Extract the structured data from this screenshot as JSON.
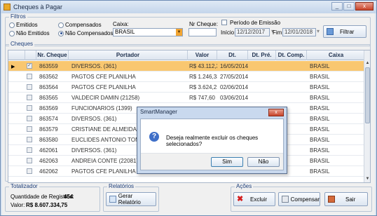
{
  "window": {
    "title": "Cheques à Pagar",
    "min": "_",
    "max": "□",
    "close": "x"
  },
  "filtros": {
    "legend": "Filtros",
    "radios_left": [
      {
        "label": "Emitidos",
        "checked": false
      },
      {
        "label": "Não Emitidos",
        "checked": false
      }
    ],
    "radios_mid": [
      {
        "label": "Compensados",
        "checked": false
      },
      {
        "label": "Não Compensados",
        "checked": true
      }
    ],
    "caixa_label": "Caixa:",
    "caixa_value": "BRASIL",
    "nr_cheque_label": "Nr Cheque:",
    "nr_cheque_value": "",
    "periodo_label": "Período de Emissão",
    "inicio_label": "Início:",
    "inicio_value": "12/12/2017",
    "fim_label": "Fim:",
    "fim_value": "12/01/2018",
    "filtrar_label": "Filtrar"
  },
  "grid": {
    "legend": "Cheques",
    "columns": [
      "Nr. Cheque",
      "Portador",
      "Valor",
      "Dt. Emissão",
      "Dt. Pré.",
      "Dt. Comp.",
      "Caixa"
    ],
    "rows": [
      {
        "nr": "863559",
        "portador": "DIVERSOS. (361)",
        "valor": "R$ 43.112,34",
        "emissao": "16/05/2014",
        "pre": "",
        "comp": "",
        "caixa": "BRASIL",
        "selected": true
      },
      {
        "nr": "863562",
        "portador": "PAGTOS CFE PLANILHA",
        "valor": "R$ 1.246,33",
        "emissao": "27/05/2014",
        "pre": "",
        "comp": "",
        "caixa": "BRASIL",
        "selected": false
      },
      {
        "nr": "863564",
        "portador": "PAGTOS CFE PLANILHA",
        "valor": "R$ 3.624,21",
        "emissao": "02/06/2014",
        "pre": "",
        "comp": "",
        "caixa": "BRASIL",
        "selected": false
      },
      {
        "nr": "863565",
        "portador": "VALDECIR DAMIN (21258)",
        "valor": "R$ 747,60",
        "emissao": "03/06/2014",
        "pre": "",
        "comp": "",
        "caixa": "BRASIL",
        "selected": false
      },
      {
        "nr": "863569",
        "portador": "FUNCIONARIOS (1399)",
        "valor": "",
        "emissao": "",
        "pre": "",
        "comp": "",
        "caixa": "BRASIL",
        "selected": false
      },
      {
        "nr": "863574",
        "portador": "DIVERSOS. (361)",
        "valor": "",
        "emissao": "",
        "pre": "",
        "comp": "",
        "caixa": "BRASIL",
        "selected": false
      },
      {
        "nr": "863579",
        "portador": "CRISTIANE DE ALMEIDA (223",
        "valor": "",
        "emissao": "",
        "pre": "",
        "comp": "",
        "caixa": "BRASIL",
        "selected": false
      },
      {
        "nr": "863580",
        "portador": "EUCLIDES ANTONIO TOMKIEL",
        "valor": "",
        "emissao": "",
        "pre": "",
        "comp": "",
        "caixa": "BRASIL",
        "selected": false
      },
      {
        "nr": "462061",
        "portador": "DIVERSOS. (361)",
        "valor": "",
        "emissao": "",
        "pre": "",
        "comp": "",
        "caixa": "BRASIL",
        "selected": false
      },
      {
        "nr": "462063",
        "portador": "ANDREIA CONTE (22081)",
        "valor": "",
        "emissao": "",
        "pre": "",
        "comp": "",
        "caixa": "BRASIL",
        "selected": false
      },
      {
        "nr": "462062",
        "portador": "PAGTOS CFE PLANILHA",
        "valor": "",
        "emissao": "",
        "pre": "",
        "comp": "",
        "caixa": "BRASIL",
        "selected": false
      }
    ]
  },
  "totalizador": {
    "legend": "Totalizador",
    "qtd_label": "Quantidade de Registros:",
    "qtd_value": "454",
    "valor_label": "Valor:",
    "valor_value": "R$ 8.607.334,75"
  },
  "relatorios": {
    "legend": "Relatórios",
    "gerar_label": "Gerar Relatório"
  },
  "acoes": {
    "legend": "Ações",
    "excluir_label": "Excluir",
    "compensar_label": "Compensar",
    "sair_label": "Sair"
  },
  "dialog": {
    "title": "SmartManager",
    "close": "x",
    "message": "Deseja realmente excluir os cheques selecionados?",
    "sim": "Sim",
    "nao": "Não"
  },
  "colors": {
    "selection": "#f9c770",
    "accent": "#2b4f92"
  }
}
